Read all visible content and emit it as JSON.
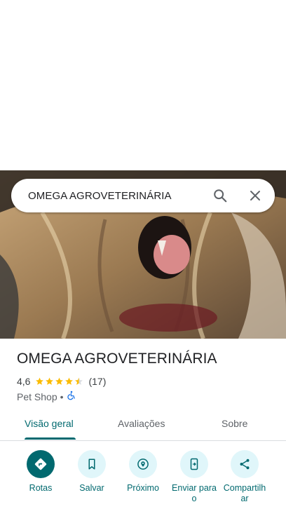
{
  "search": {
    "query": "OMEGA AGROVETERINÁRIA"
  },
  "place": {
    "name": "OMEGA AGROVETERINÁRIA",
    "rating": "4,6",
    "stars": 4.5,
    "review_count": "(17)",
    "category": "Pet Shop",
    "separator": "•"
  },
  "tabs": [
    {
      "label": "Visão geral",
      "active": true
    },
    {
      "label": "Avaliações",
      "active": false
    },
    {
      "label": "Sobre",
      "active": false
    }
  ],
  "actions": [
    {
      "label": "Rotas",
      "icon": "directions-icon"
    },
    {
      "label": "Salvar",
      "icon": "bookmark-icon"
    },
    {
      "label": "Próximo",
      "icon": "nearby-icon"
    },
    {
      "label": "Enviar para o",
      "icon": "send-to-phone-icon"
    },
    {
      "label": "Compartilhar",
      "icon": "share-icon"
    }
  ],
  "colors": {
    "accent": "#01696f",
    "accent_light": "#e0f6fa",
    "star": "#fbbc04"
  }
}
